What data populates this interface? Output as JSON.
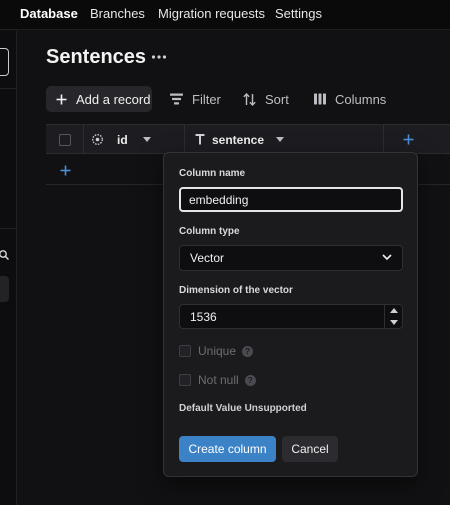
{
  "nav": {
    "items": [
      {
        "label": "Database",
        "active": true
      },
      {
        "label": "Branches",
        "active": false
      },
      {
        "label": "Migration requests",
        "active": false
      },
      {
        "label": "Settings",
        "active": false
      }
    ]
  },
  "page": {
    "title": "Sentences",
    "more_icon": "more-horizontal-icon"
  },
  "toolbar": {
    "add_record": "Add a record",
    "filter": "Filter",
    "sort": "Sort",
    "columns": "Columns"
  },
  "grid": {
    "columns": [
      {
        "name": "id",
        "icon": "id-column-icon"
      },
      {
        "name": "sentence",
        "icon": "text-type-icon"
      }
    ],
    "add_column_icon": "plus-icon",
    "add_row_icon": "plus-icon"
  },
  "popover": {
    "column_name_label": "Column name",
    "column_name_value": "embedding",
    "column_type_label": "Column type",
    "column_type_value": "Vector",
    "dimension_label": "Dimension of the vector",
    "dimension_value": "1536",
    "unique_label": "Unique",
    "not_null_label": "Not null",
    "help_glyph": "?",
    "default_note": "Default Value Unsupported",
    "create_button": "Create column",
    "cancel_button": "Cancel"
  },
  "colors": {
    "background": "#111113",
    "primary_button": "#3b82c7",
    "accent_plus": "#4c8ed8"
  }
}
